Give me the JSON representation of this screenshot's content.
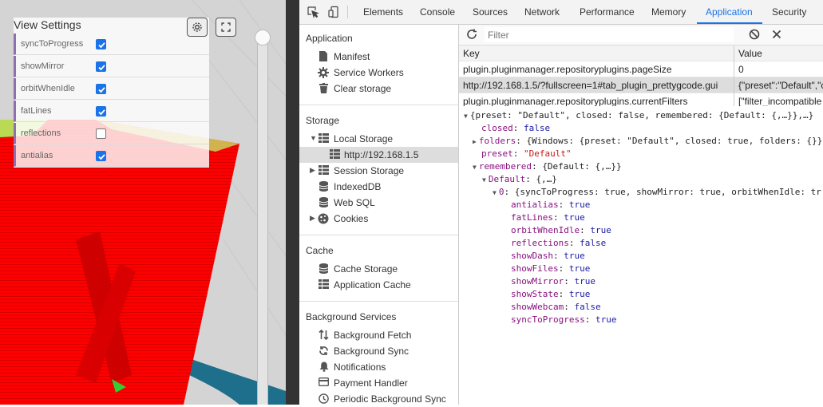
{
  "viewer": {
    "panel_title": "View Settings",
    "settings": [
      {
        "label": "syncToProgress",
        "checked": true
      },
      {
        "label": "showMirror",
        "checked": true
      },
      {
        "label": "orbitWhenIdle",
        "checked": true
      },
      {
        "label": "fatLines",
        "checked": true
      },
      {
        "label": "reflections",
        "checked": false
      },
      {
        "label": "antialias",
        "checked": true
      }
    ],
    "colors": {
      "model": "#ff0000",
      "floor": "#d2d2d2",
      "ring": "#1e6f8c"
    }
  },
  "devtools": {
    "tabs": [
      "Elements",
      "Console",
      "Sources",
      "Network",
      "Performance",
      "Memory",
      "Application",
      "Security"
    ],
    "active_tab": "Application",
    "sidebar": {
      "application": {
        "title": "Application",
        "items": [
          {
            "label": "Manifest",
            "icon": "document-icon"
          },
          {
            "label": "Service Workers",
            "icon": "gear-icon"
          },
          {
            "label": "Clear storage",
            "icon": "trash-icon"
          }
        ]
      },
      "storage": {
        "title": "Storage",
        "local_storage": "Local Storage",
        "local_origin": "http://192.168.1.5",
        "session_storage": "Session Storage",
        "indexeddb": "IndexedDB",
        "websql": "Web SQL",
        "cookies": "Cookies"
      },
      "cache": {
        "title": "Cache",
        "items": [
          "Cache Storage",
          "Application Cache"
        ]
      },
      "background": {
        "title": "Background Services",
        "items": [
          "Background Fetch",
          "Background Sync",
          "Notifications",
          "Payment Handler",
          "Periodic Background Sync"
        ]
      }
    },
    "filter": {
      "placeholder": "Filter"
    },
    "table": {
      "key_header": "Key",
      "value_header": "Value",
      "rows": [
        {
          "key": "plugin.pluginmanager.repositoryplugins.pageSize",
          "value": "0"
        },
        {
          "key": "http://192.168.1.5/?fullscreen=1#tab_plugin_prettygcode.gui",
          "value": "{\"preset\":\"Default\",\"c"
        },
        {
          "key": "plugin.pluginmanager.repositoryplugins.currentFilters",
          "value": "[\"filter_incompatible"
        }
      ]
    },
    "tree": {
      "root": "{preset: \"Default\", closed: false, remembered: {Default: {,…}},…}",
      "closed_key": "closed",
      "closed_val": "false",
      "folders_key": "folders",
      "folders_val": "{Windows: {preset: \"Default\", closed: true, folders: {}}",
      "preset_key": "preset",
      "preset_val": "\"Default\"",
      "remembered_key": "remembered",
      "remembered_val": "{Default: {,…}}",
      "default_key": "Default",
      "default_val": "{,…}",
      "zero_key": "0",
      "zero_val": "{syncToProgress: true, showMirror: true, orbitWhenIdle: tr",
      "props": [
        {
          "key": "antialias",
          "value": "true"
        },
        {
          "key": "fatLines",
          "value": "true"
        },
        {
          "key": "orbitWhenIdle",
          "value": "true"
        },
        {
          "key": "reflections",
          "value": "false"
        },
        {
          "key": "showDash",
          "value": "true"
        },
        {
          "key": "showFiles",
          "value": "true"
        },
        {
          "key": "showMirror",
          "value": "true"
        },
        {
          "key": "showState",
          "value": "true"
        },
        {
          "key": "showWebcam",
          "value": "false"
        },
        {
          "key": "syncToProgress",
          "value": "true"
        }
      ]
    }
  }
}
